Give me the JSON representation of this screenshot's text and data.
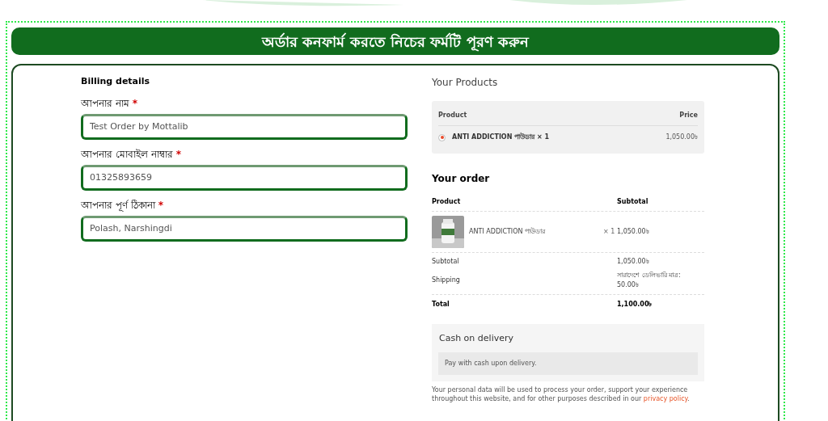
{
  "banner": {
    "title": "অর্ডার কনফার্ম করতে নিচের ফর্মটি পূরণ করুন"
  },
  "billing": {
    "heading": "Billing details",
    "fields": [
      {
        "label": "আপনার নাম",
        "required_mark": "*",
        "value": "Test Order by Mottalib"
      },
      {
        "label": "আপনার মোবাইল নাম্বার",
        "required_mark": "*",
        "value": "01325893659"
      },
      {
        "label": "আপনার পূর্ণ ঠিকানা",
        "required_mark": "*",
        "value": "Polash, Narshingdi"
      }
    ]
  },
  "products": {
    "heading": "Your Products",
    "columns": [
      "Product",
      "Price"
    ],
    "items": [
      {
        "name": "ANTI ADDICTION পাউডার",
        "qty": "× 1",
        "price": "1,050.00৳",
        "selected": true
      }
    ]
  },
  "order": {
    "heading": "Your order",
    "columns": [
      "Product",
      "Subtotal"
    ],
    "items": [
      {
        "name": "ANTI ADDICTION পাউডার",
        "qty": "× 1",
        "subtotal": "1,050.00৳"
      }
    ],
    "subtotal": {
      "label": "Subtotal",
      "value": "1,050.00৳"
    },
    "shipping": {
      "label": "Shipping",
      "method": "সারাদেশে ডেলিভারি মাত্র:",
      "value": "50.00৳"
    },
    "total": {
      "label": "Total",
      "value": "1,100.00৳"
    }
  },
  "payment": {
    "method": "Cash on delivery",
    "description": "Pay with cash upon delivery."
  },
  "privacy": {
    "text": "Your personal data will be used to process your order, support your experience throughout this website, and for other purposes described in our ",
    "link": "privacy policy",
    "end": "."
  }
}
